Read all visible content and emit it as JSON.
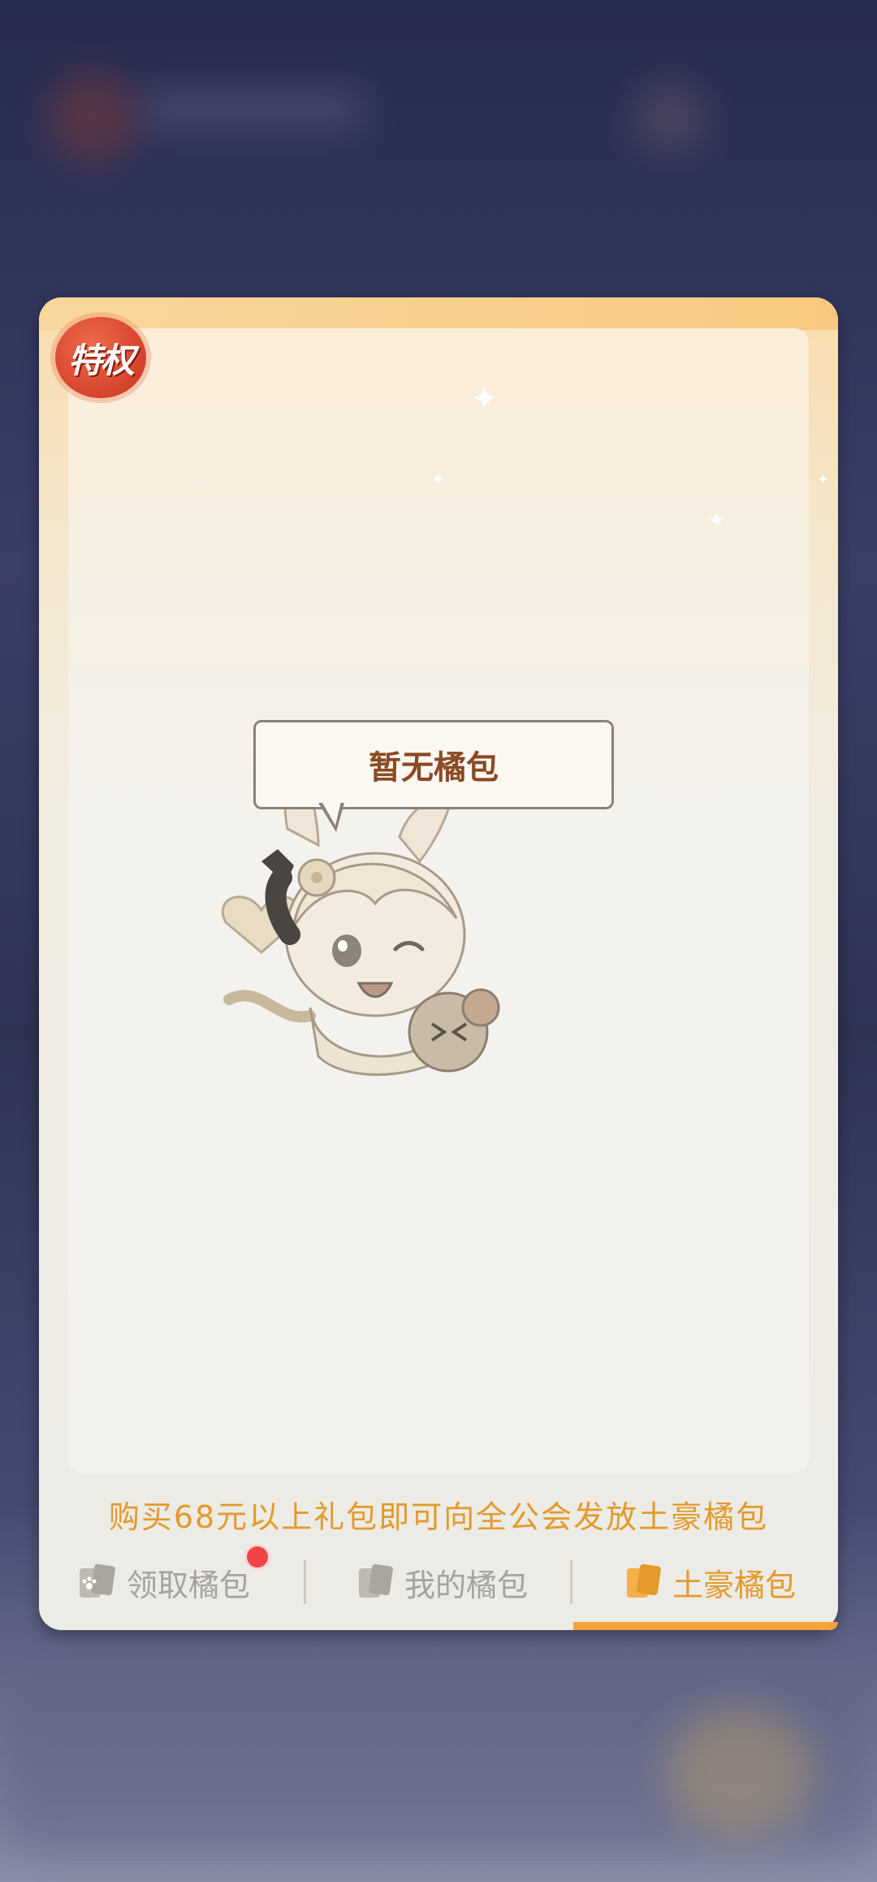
{
  "badge": {
    "label": "特权"
  },
  "empty_state": {
    "message": "暂无橘包"
  },
  "promo": {
    "text": "购买68元以上礼包即可向全公会发放土豪橘包"
  },
  "tabs": [
    {
      "label": "领取橘包",
      "icon": "paw-card-icon",
      "active": false,
      "has_notification": true
    },
    {
      "label": "我的橘包",
      "icon": "card-icon",
      "active": false,
      "has_notification": false
    },
    {
      "label": "土豪橘包",
      "icon": "card-icon",
      "active": true,
      "has_notification": false
    }
  ],
  "colors": {
    "accent": "#e39a2a",
    "inactive": "#a6a39e",
    "notification": "#f0444a",
    "panel_warm": "#f9dcaa"
  }
}
